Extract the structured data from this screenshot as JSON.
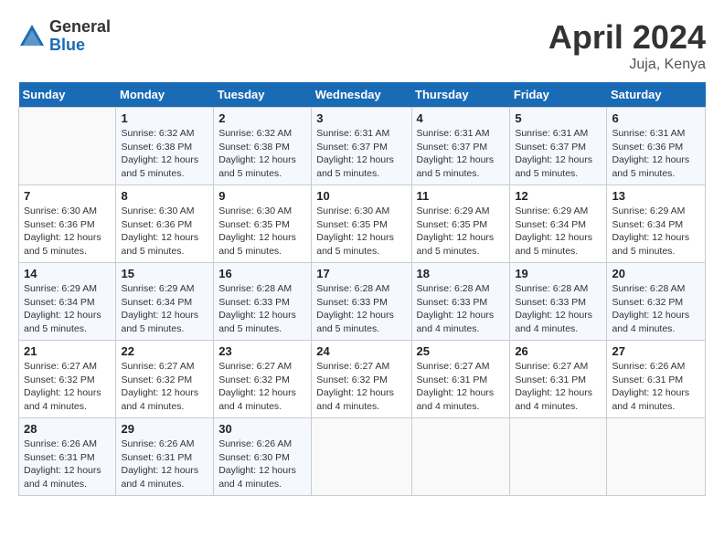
{
  "logo": {
    "general": "General",
    "blue": "Blue"
  },
  "header": {
    "title": "April 2024",
    "location": "Juja, Kenya"
  },
  "weekdays": [
    "Sunday",
    "Monday",
    "Tuesday",
    "Wednesday",
    "Thursday",
    "Friday",
    "Saturday"
  ],
  "weeks": [
    [
      {
        "day": "",
        "info": ""
      },
      {
        "day": "1",
        "info": "Sunrise: 6:32 AM\nSunset: 6:38 PM\nDaylight: 12 hours\nand 5 minutes."
      },
      {
        "day": "2",
        "info": "Sunrise: 6:32 AM\nSunset: 6:38 PM\nDaylight: 12 hours\nand 5 minutes."
      },
      {
        "day": "3",
        "info": "Sunrise: 6:31 AM\nSunset: 6:37 PM\nDaylight: 12 hours\nand 5 minutes."
      },
      {
        "day": "4",
        "info": "Sunrise: 6:31 AM\nSunset: 6:37 PM\nDaylight: 12 hours\nand 5 minutes."
      },
      {
        "day": "5",
        "info": "Sunrise: 6:31 AM\nSunset: 6:37 PM\nDaylight: 12 hours\nand 5 minutes."
      },
      {
        "day": "6",
        "info": "Sunrise: 6:31 AM\nSunset: 6:36 PM\nDaylight: 12 hours\nand 5 minutes."
      }
    ],
    [
      {
        "day": "7",
        "info": "Sunrise: 6:30 AM\nSunset: 6:36 PM\nDaylight: 12 hours\nand 5 minutes."
      },
      {
        "day": "8",
        "info": "Sunrise: 6:30 AM\nSunset: 6:36 PM\nDaylight: 12 hours\nand 5 minutes."
      },
      {
        "day": "9",
        "info": "Sunrise: 6:30 AM\nSunset: 6:35 PM\nDaylight: 12 hours\nand 5 minutes."
      },
      {
        "day": "10",
        "info": "Sunrise: 6:30 AM\nSunset: 6:35 PM\nDaylight: 12 hours\nand 5 minutes."
      },
      {
        "day": "11",
        "info": "Sunrise: 6:29 AM\nSunset: 6:35 PM\nDaylight: 12 hours\nand 5 minutes."
      },
      {
        "day": "12",
        "info": "Sunrise: 6:29 AM\nSunset: 6:34 PM\nDaylight: 12 hours\nand 5 minutes."
      },
      {
        "day": "13",
        "info": "Sunrise: 6:29 AM\nSunset: 6:34 PM\nDaylight: 12 hours\nand 5 minutes."
      }
    ],
    [
      {
        "day": "14",
        "info": "Sunrise: 6:29 AM\nSunset: 6:34 PM\nDaylight: 12 hours\nand 5 minutes."
      },
      {
        "day": "15",
        "info": "Sunrise: 6:29 AM\nSunset: 6:34 PM\nDaylight: 12 hours\nand 5 minutes."
      },
      {
        "day": "16",
        "info": "Sunrise: 6:28 AM\nSunset: 6:33 PM\nDaylight: 12 hours\nand 5 minutes."
      },
      {
        "day": "17",
        "info": "Sunrise: 6:28 AM\nSunset: 6:33 PM\nDaylight: 12 hours\nand 5 minutes."
      },
      {
        "day": "18",
        "info": "Sunrise: 6:28 AM\nSunset: 6:33 PM\nDaylight: 12 hours\nand 4 minutes."
      },
      {
        "day": "19",
        "info": "Sunrise: 6:28 AM\nSunset: 6:33 PM\nDaylight: 12 hours\nand 4 minutes."
      },
      {
        "day": "20",
        "info": "Sunrise: 6:28 AM\nSunset: 6:32 PM\nDaylight: 12 hours\nand 4 minutes."
      }
    ],
    [
      {
        "day": "21",
        "info": "Sunrise: 6:27 AM\nSunset: 6:32 PM\nDaylight: 12 hours\nand 4 minutes."
      },
      {
        "day": "22",
        "info": "Sunrise: 6:27 AM\nSunset: 6:32 PM\nDaylight: 12 hours\nand 4 minutes."
      },
      {
        "day": "23",
        "info": "Sunrise: 6:27 AM\nSunset: 6:32 PM\nDaylight: 12 hours\nand 4 minutes."
      },
      {
        "day": "24",
        "info": "Sunrise: 6:27 AM\nSunset: 6:32 PM\nDaylight: 12 hours\nand 4 minutes."
      },
      {
        "day": "25",
        "info": "Sunrise: 6:27 AM\nSunset: 6:31 PM\nDaylight: 12 hours\nand 4 minutes."
      },
      {
        "day": "26",
        "info": "Sunrise: 6:27 AM\nSunset: 6:31 PM\nDaylight: 12 hours\nand 4 minutes."
      },
      {
        "day": "27",
        "info": "Sunrise: 6:26 AM\nSunset: 6:31 PM\nDaylight: 12 hours\nand 4 minutes."
      }
    ],
    [
      {
        "day": "28",
        "info": "Sunrise: 6:26 AM\nSunset: 6:31 PM\nDaylight: 12 hours\nand 4 minutes."
      },
      {
        "day": "29",
        "info": "Sunrise: 6:26 AM\nSunset: 6:31 PM\nDaylight: 12 hours\nand 4 minutes."
      },
      {
        "day": "30",
        "info": "Sunrise: 6:26 AM\nSunset: 6:30 PM\nDaylight: 12 hours\nand 4 minutes."
      },
      {
        "day": "",
        "info": ""
      },
      {
        "day": "",
        "info": ""
      },
      {
        "day": "",
        "info": ""
      },
      {
        "day": "",
        "info": ""
      }
    ]
  ]
}
